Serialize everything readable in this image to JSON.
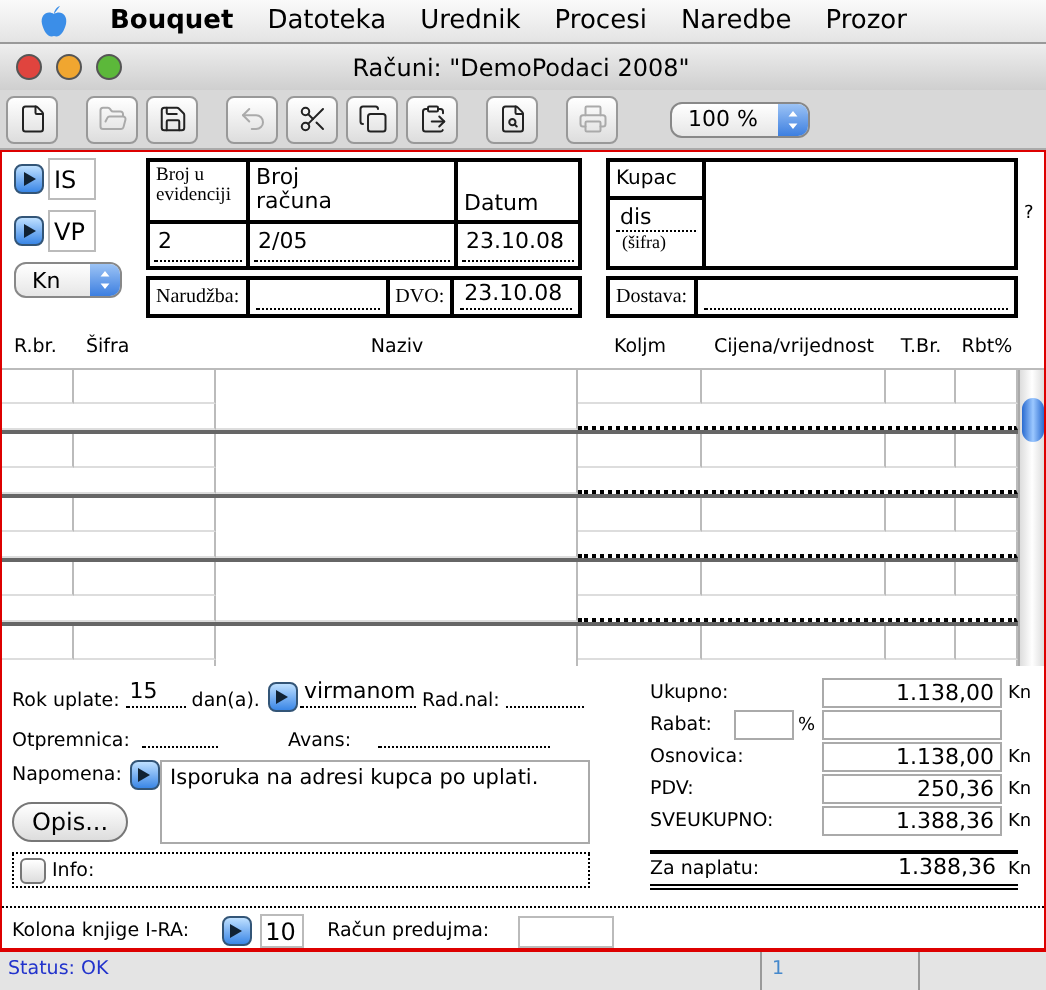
{
  "menu_bar": {
    "app_name": "Bouquet",
    "items": [
      "Datoteka",
      "Urednik",
      "Procesi",
      "Naredbe",
      "Prozor"
    ]
  },
  "window": {
    "title": "Računi: \"DemoPodaci 2008\""
  },
  "toolbar": {
    "buttons": [
      {
        "kind": "new",
        "disabled": false
      },
      {
        "kind": "open",
        "disabled": true
      },
      {
        "kind": "save",
        "disabled": false
      },
      {
        "kind": "undo",
        "disabled": true
      },
      {
        "kind": "cut",
        "disabled": false
      },
      {
        "kind": "copy",
        "disabled": false
      },
      {
        "kind": "paste",
        "disabled": false
      },
      {
        "kind": "preview",
        "disabled": false
      },
      {
        "kind": "print",
        "disabled": true
      }
    ],
    "zoom": "100 %"
  },
  "document_codes": [
    "IS",
    "VP"
  ],
  "currency": "Kn",
  "invoice_header": {
    "fields": [
      {
        "label": "Broj u\nevidenciji",
        "value": "2"
      },
      {
        "label": "Broj\nračuna",
        "value": "2/05"
      },
      {
        "label": "Datum",
        "value": "23.10.08"
      }
    ]
  },
  "customer": {
    "label": "Kupac",
    "code": "dis",
    "code_hint": "(šifra)",
    "help": "?"
  },
  "order_row": {
    "order_label": "Narudžba:",
    "dvo_label": "DVO:",
    "dvo": "23.10.08",
    "delivery_label": "Dostava:"
  },
  "items_table": {
    "columns": [
      "R.br.",
      "Šifra",
      "Naziv",
      "Koljm",
      "Cijena/vrijednost",
      "T.Br.",
      "Rbt%"
    ]
  },
  "payment": {
    "term_label": "Rok uplate:",
    "term_days": "15",
    "days_unit": "dan(a).",
    "method": "virmanom",
    "work_order_label": "Rad.nal:",
    "dispatch_label": "Otpremnica:",
    "advance_label": "Avans:",
    "note_label": "Napomena:",
    "note": "Isporuka na adresi kupca po uplati.",
    "description_button": "Opis...",
    "info_label": "Info:",
    "info_checked": false,
    "ira_label": "Kolona knjige I-RA:",
    "ira_column": "10",
    "prepayment_label": "Račun predujma:"
  },
  "totals": {
    "rows": [
      {
        "kind": "amount",
        "label": "Ukupno:",
        "value": "1.138,00",
        "unit": "Kn"
      },
      {
        "kind": "discount",
        "label": "Rabat:",
        "percent_sign": "%"
      },
      {
        "kind": "amount",
        "label": "Osnovica:",
        "value": "1.138,00",
        "unit": "Kn"
      },
      {
        "kind": "amount",
        "label": "PDV:",
        "value": "250,36",
        "unit": "Kn"
      },
      {
        "kind": "amount",
        "label": "SVEUKUPNO:",
        "value": "1.388,36",
        "unit": "Kn"
      },
      {
        "kind": "due",
        "label": "Za naplatu:",
        "value": "1.388,36",
        "unit": "Kn"
      }
    ]
  },
  "status_bar": {
    "status": "Status: OK",
    "page": "1"
  }
}
